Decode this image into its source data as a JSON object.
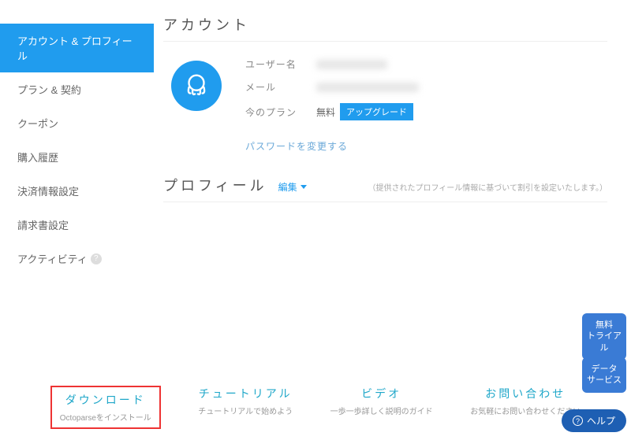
{
  "sidebar": {
    "items": [
      {
        "label": "アカウント & プロフィール",
        "active": true
      },
      {
        "label": "プラン & 契約"
      },
      {
        "label": "クーポン"
      },
      {
        "label": "購入履歴"
      },
      {
        "label": "決済情報設定"
      },
      {
        "label": "請求書設定"
      },
      {
        "label": "アクティビティ",
        "help": true
      }
    ]
  },
  "account": {
    "title": "アカウント",
    "fields": {
      "username_label": "ユーザー名",
      "email_label": "メール",
      "plan_label": "今のプラン",
      "plan_value": "無料",
      "upgrade_label": "アップグレード"
    },
    "password_link": "パスワードを変更する"
  },
  "profile": {
    "title": "プロフィール",
    "edit_label": "編集",
    "note": "（提供されたプロフィール情報に基づいて割引を設定いたします。）"
  },
  "footer": [
    {
      "title": "ダウンロード",
      "sub": "Octoparseをインストール",
      "highlight": true
    },
    {
      "title": "チュートリアル",
      "sub": "チュートリアルで始めよう"
    },
    {
      "title": "ビデオ",
      "sub": "一歩一歩詳しく説明のガイド"
    },
    {
      "title": "お問い合わせ",
      "sub": "お気軽にお問い合わせください"
    }
  ],
  "floating": {
    "trial": "無料\nトライアル",
    "data": "データ\nサービス",
    "help": "ヘルプ"
  }
}
